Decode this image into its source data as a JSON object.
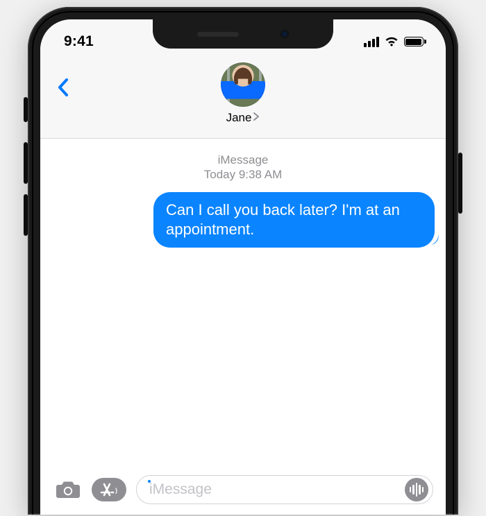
{
  "status": {
    "time": "9:41"
  },
  "header": {
    "contact_name": "Jane"
  },
  "thread": {
    "service_label": "iMessage",
    "timestamp": "Today 9:38 AM",
    "messages": [
      {
        "text": "Can I call you back later? I'm at an appointment.",
        "direction": "outgoing"
      }
    ]
  },
  "compose": {
    "placeholder": "iMessage"
  },
  "colors": {
    "accent": "#007aff",
    "bubble_outgoing": "#0a84ff",
    "muted": "#8e8e93"
  }
}
